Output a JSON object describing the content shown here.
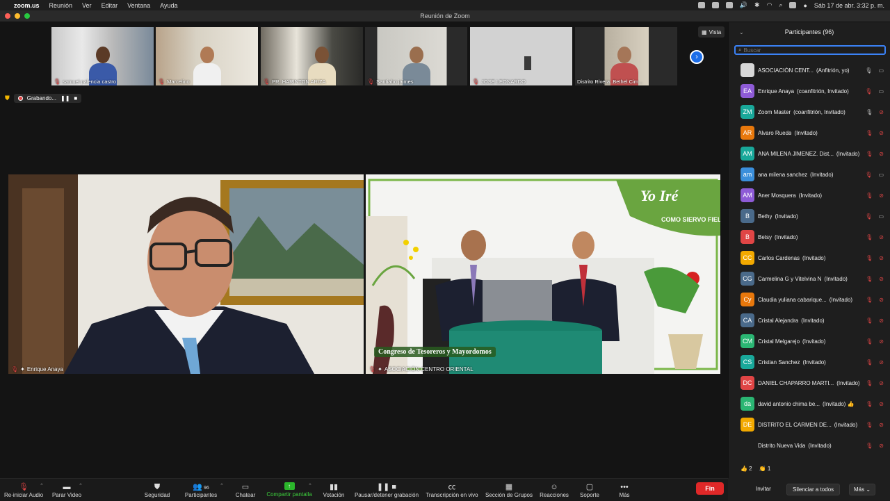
{
  "menubar": {
    "app": "zoom.us",
    "items": [
      "Reunión",
      "Ver",
      "Editar",
      "Ventana",
      "Ayuda"
    ],
    "datetime": "Sáb 17 de abr.  3:32 p. m."
  },
  "window": {
    "title": "Reunión de Zoom"
  },
  "top_strip": {
    "view_label": "Vista",
    "participants": [
      {
        "name": "samuel palencia castro"
      },
      {
        "name": "Marcelino"
      },
      {
        "name": "PR. HARINTON ARIZA"
      },
      {
        "name": "Santiaho jaimes"
      },
      {
        "name": "JOSE LEONARDO"
      },
      {
        "name": "Distrito Rivera..Bethel Cim..."
      }
    ]
  },
  "recording": {
    "label": "Grabando..."
  },
  "main_videos": [
    {
      "name": "Enrique Anaya"
    },
    {
      "name": "ASOCIACIÓN CENTRO ORIENTAL",
      "banner": "Congreso de Tesoreros y Mayordomos",
      "brand_title": "Yo Iré",
      "brand_subtitle": "COMO SIERVO FIEL"
    }
  ],
  "panel": {
    "title": "Participantes (96)",
    "search_placeholder": "Buscar",
    "participants": [
      {
        "initials": "",
        "name": "ASOCIACIÓN CENT...",
        "role": "(Anfitrión, yo)",
        "color": "#d8d8d8",
        "mic": "on",
        "cam": "on"
      },
      {
        "initials": "EA",
        "name": "Enrique Anaya",
        "role": "(coanfitrión, Invitado)",
        "color": "#8e5bd6",
        "mic": "off",
        "cam": "on"
      },
      {
        "initials": "ZM",
        "name": "Zoom Master",
        "role": "(coanfitrión, Invitado)",
        "color": "#19a89a",
        "mic": "on",
        "cam": "off"
      },
      {
        "initials": "AR",
        "name": "Alvaro Rueda",
        "role": "(Invitado)",
        "color": "#e8780c",
        "mic": "off",
        "cam": "off"
      },
      {
        "initials": "AM",
        "name": "ANA MILENA JIMENEZ. Dist...",
        "role": "(Invitado)",
        "color": "#19a89a",
        "mic": "off",
        "cam": "off"
      },
      {
        "initials": "am",
        "name": "ana milena sanchez",
        "role": "(Invitado)",
        "color": "#3b8fdb",
        "mic": "off",
        "cam": "on"
      },
      {
        "initials": "AM",
        "name": "Aner Mosquera",
        "role": "(Invitado)",
        "color": "#8e5bd6",
        "mic": "off",
        "cam": "off"
      },
      {
        "initials": "B",
        "name": "Bethy",
        "role": "(Invitado)",
        "color": "#4a6a8a",
        "mic": "off",
        "cam": "on"
      },
      {
        "initials": "B",
        "name": "Betsy",
        "role": "(Invitado)",
        "color": "#e04545",
        "mic": "off",
        "cam": "off"
      },
      {
        "initials": "CC",
        "name": "Carlos Cardenas",
        "role": "(Invitado)",
        "color": "#f2a900",
        "mic": "off",
        "cam": "off"
      },
      {
        "initials": "CG",
        "name": "Carmelina G y Vitelvina N",
        "role": "(Invitado)",
        "color": "#4a6a8a",
        "mic": "off",
        "cam": "off"
      },
      {
        "initials": "Cy",
        "name": "Claudia yuliana cabarique...",
        "role": "(Invitado)",
        "color": "#e8780c",
        "mic": "off",
        "cam": "off"
      },
      {
        "initials": "CA",
        "name": "Cristal Alejandra",
        "role": "(Invitado)",
        "color": "#4a6a8a",
        "mic": "off",
        "cam": "off"
      },
      {
        "initials": "CM",
        "name": "Cristal Melgarejo",
        "role": "(Invitado)",
        "color": "#2bb673",
        "mic": "off",
        "cam": "off"
      },
      {
        "initials": "CS",
        "name": "Cristian Sanchez",
        "role": "(Invitado)",
        "color": "#19a89a",
        "mic": "off",
        "cam": "off"
      },
      {
        "initials": "DC",
        "name": "DANIEL CHAPARRO MARTI...",
        "role": "(Invitado)",
        "color": "#e04545",
        "mic": "off",
        "cam": "off"
      },
      {
        "initials": "da",
        "name": "david antonio chima be...",
        "role": "(Invitado) 👍",
        "color": "#2bb673",
        "mic": "off",
        "cam": "off"
      },
      {
        "initials": "DE",
        "name": "DISTRITO EL CARMEN DE...",
        "role": "(Invitado)",
        "color": "#f2a900",
        "mic": "off",
        "cam": "off"
      },
      {
        "initials": "",
        "name": "Distrito Nueva Vida",
        "role": "(Invitado)",
        "color": "#1e1e1e",
        "mic": "off",
        "cam": "off"
      }
    ],
    "reactions": {
      "thumbs": "👍 2",
      "clap": "👏 1"
    },
    "invite": "Invitar",
    "mute_all": "Silenciar a todos",
    "more": "Más"
  },
  "toolbar": {
    "audio": "Re-iniciar Audio",
    "video": "Parar Video",
    "security": "Seguridad",
    "participants": "Participantes",
    "participants_count": "96",
    "chat": "Chatear",
    "share": "Compartir pantalla",
    "poll": "Votación",
    "record": "Pausar/detener grabación",
    "transcript": "Transcripción en vivo",
    "breakout": "Sección de Grupos",
    "reactions": "Reacciones",
    "support": "Soporte",
    "more": "Más",
    "end": "Fin"
  }
}
